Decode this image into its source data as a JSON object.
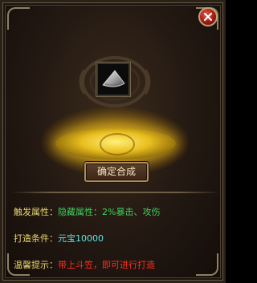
{
  "dialog": {
    "close_icon": "close-icon",
    "confirm_label": "确定合成",
    "item_icon": "bamboo-hat-icon"
  },
  "info": {
    "trigger_label": "触发属性：",
    "trigger_value": "隐藏属性：2%暴击、攻伤",
    "craft_label": "打造条件：",
    "craft_value": "元宝10000",
    "tip_label": "温馨提示：",
    "tip_value": "带上斗笠，即可进行打造"
  },
  "colors": {
    "label": "#e9d66d",
    "green": "#3fd05c",
    "cyan": "#5ee6e0",
    "red": "#ff2e1c",
    "glow": "#e9be1e"
  }
}
